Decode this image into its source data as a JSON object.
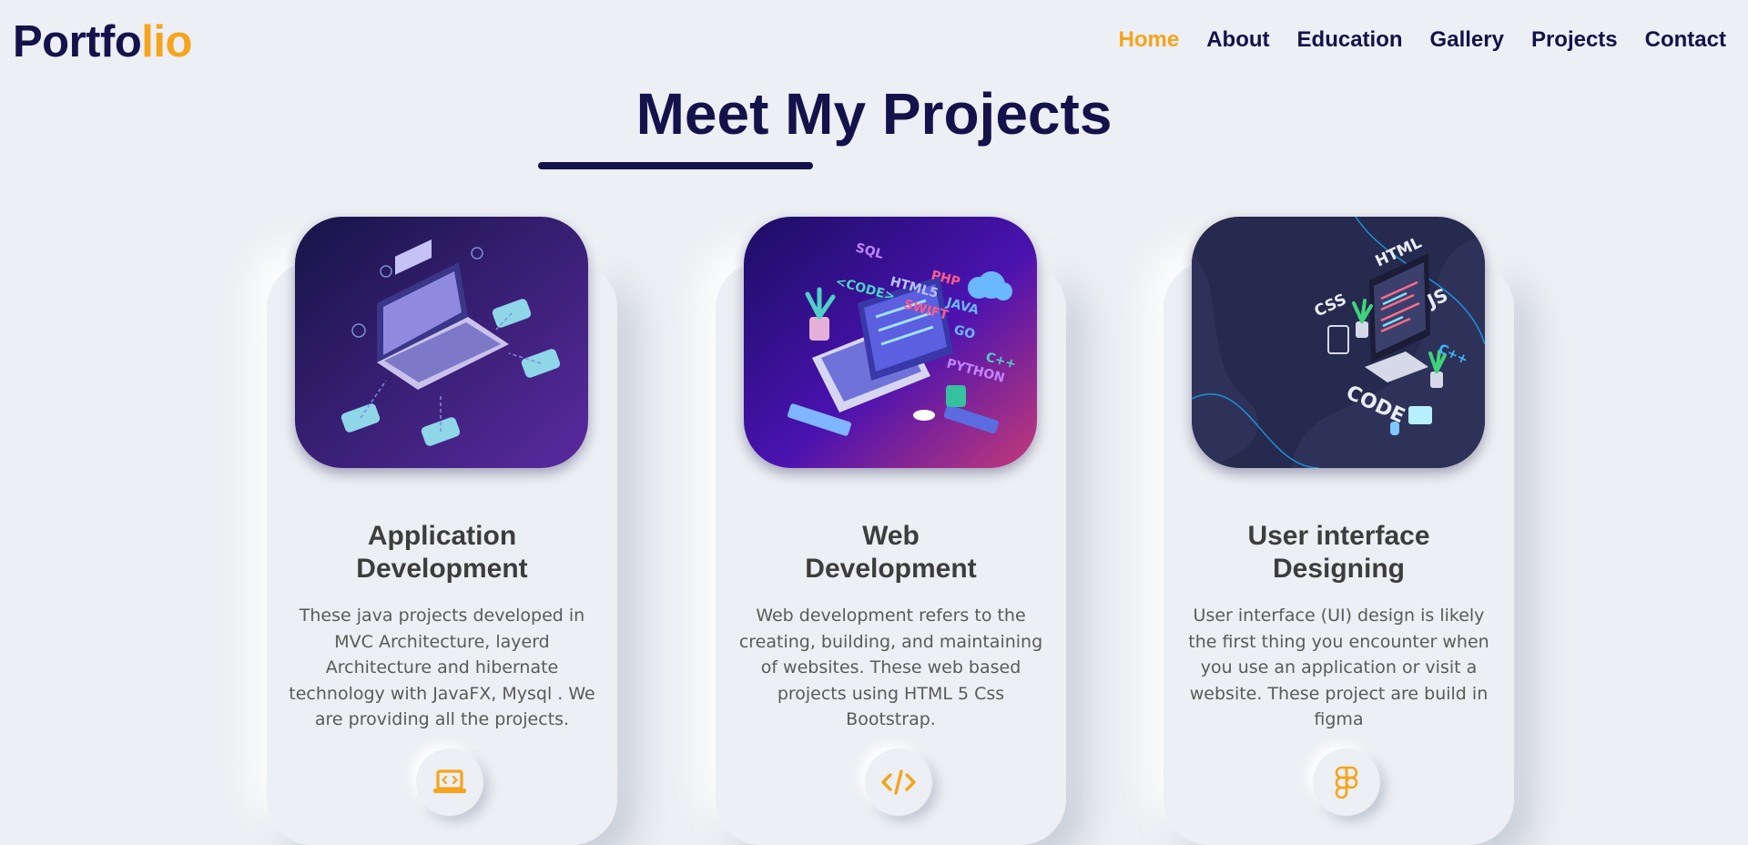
{
  "header": {
    "logo_main": "Portfo",
    "logo_accent": "lio",
    "nav": [
      "Home",
      "About",
      "Education",
      "Gallery",
      "Projects",
      "Contact"
    ],
    "active_nav": "Home"
  },
  "section": {
    "title": "Meet My Projects"
  },
  "cards": [
    {
      "title_line1": "Application",
      "title_line2": "Development",
      "description": "These java projects developed in MVC Architecture, layerd Architecture and hibernate technology with JavaFX, Mysql . We are providing all the projects.",
      "icon": "laptop-code-icon"
    },
    {
      "title_line1": "Web",
      "title_line2": "Development",
      "description": "Web development refers to the creating, building, and maintaining of websites. These web based projects using HTML 5 Css Bootstrap.",
      "icon": "code-icon"
    },
    {
      "title_line1": "User interface",
      "title_line2": "Designing",
      "description": "User interface (UI) design is likely the first thing you encounter when you use an application or visit a website. These project are build in figma",
      "icon": "figma-icon"
    }
  ],
  "illustration_text": {
    "web": [
      "SQL",
      "PHP",
      "HTML5",
      "<CODE>",
      "SWIFT",
      "JAVA",
      "GO",
      "C++",
      "PYTHON"
    ],
    "ui": [
      "HTML",
      "CSS",
      "JS",
      "C++",
      "CODE"
    ]
  },
  "colors": {
    "navy": "#14124a",
    "accent": "#f5a41c",
    "background": "#eceff3"
  }
}
